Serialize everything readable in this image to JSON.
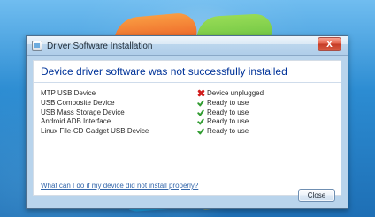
{
  "window": {
    "title": "Driver Software Installation",
    "close_glyph": "x"
  },
  "dialog": {
    "heading": "Device driver software was not successfully installed",
    "devices": [
      {
        "name": "MTP USB Device",
        "status": "Device unplugged",
        "status_icon": "error-icon",
        "status_color": "#d11d1d"
      },
      {
        "name": "USB Composite Device",
        "status": "Ready to use",
        "status_icon": "check-icon",
        "status_color": "#2f9b2f"
      },
      {
        "name": "USB Mass Storage Device",
        "status": "Ready to use",
        "status_icon": "check-icon",
        "status_color": "#2f9b2f"
      },
      {
        "name": "Android ADB Interface",
        "status": "Ready to use",
        "status_icon": "check-icon",
        "status_color": "#2f9b2f"
      },
      {
        "name": "Linux File-CD Gadget USB Device",
        "status": "Ready to use",
        "status_icon": "check-icon",
        "status_color": "#2f9b2f"
      }
    ],
    "help_link": "What can I do if my device did not install properly?",
    "close_button": "Close"
  },
  "colors": {
    "heading": "#003399",
    "link": "#3366aa",
    "window_frame": "#b9d4ec",
    "desktop": "#2f86c8"
  }
}
